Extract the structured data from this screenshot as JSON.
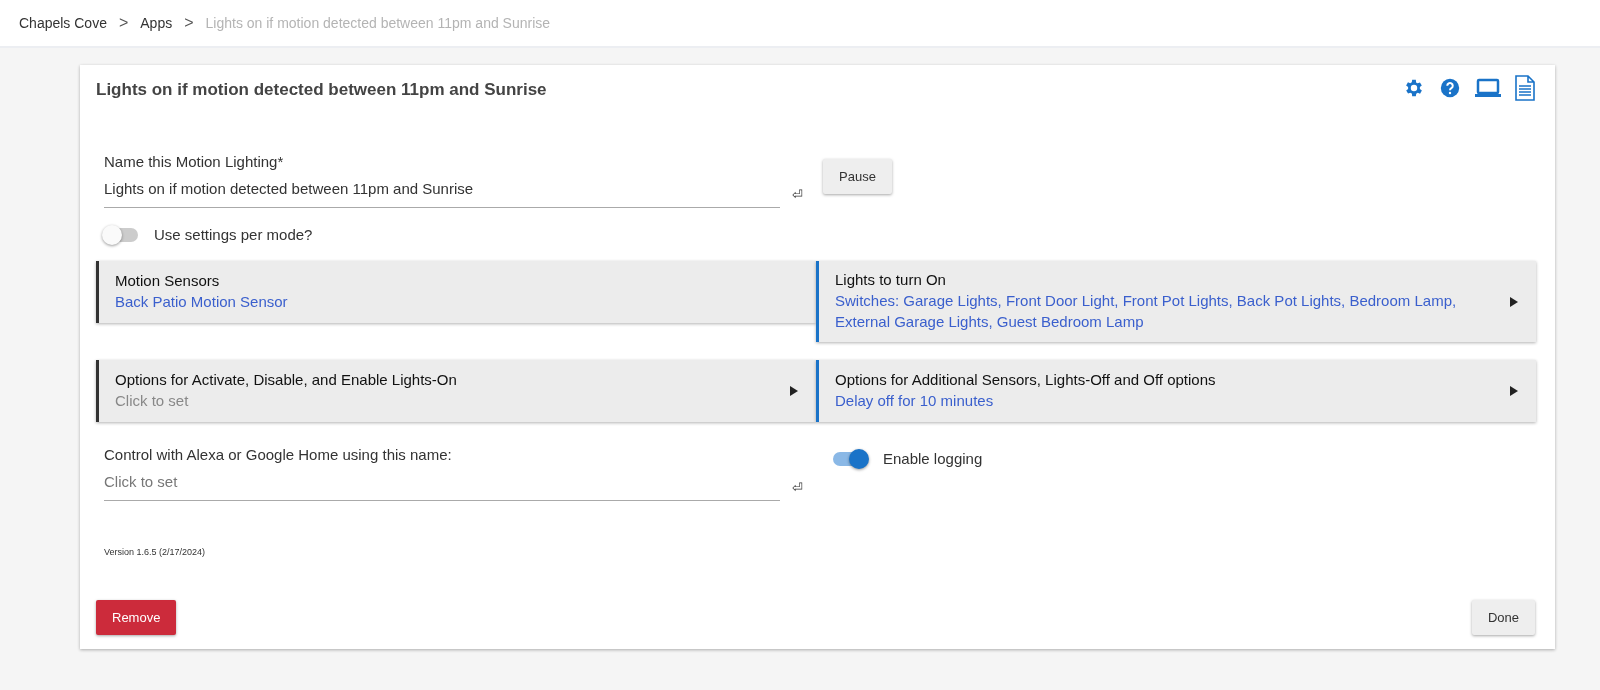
{
  "breadcrumb": [
    {
      "label": "Chapels Cove",
      "current": false
    },
    {
      "label": "Apps",
      "current": false
    },
    {
      "label": "Lights on if motion detected between 11pm and Sunrise",
      "current": true
    }
  ],
  "breadcrumb_separator": ">",
  "card": {
    "title": "Lights on if motion detected between 11pm and Sunrise"
  },
  "name_field": {
    "label": "Name this Motion Lighting*",
    "value": "Lights on if motion detected between 11pm and Sunrise",
    "enter_glyph": "⏎"
  },
  "pause_button": "Pause",
  "mode_toggle": {
    "label": "Use settings per mode?",
    "on": false
  },
  "sections": [
    {
      "title": "Motion Sensors",
      "value": "Back Patio Motion Sensor",
      "set": true,
      "arrow": false,
      "color": "#333333"
    },
    {
      "title": "Lights to turn On",
      "value": "Switches: Garage Lights, Front Door Light, Front Pot Lights, Back Pot Lights, Bedroom Lamp, External Garage Lights, Guest Bedroom Lamp",
      "set": true,
      "arrow": true,
      "color": "#1a73c8"
    },
    {
      "title": "Options for Activate, Disable, and Enable Lights-On",
      "value": "Click to set",
      "set": false,
      "arrow": true,
      "color": "#333333"
    },
    {
      "title": "Options for Additional Sensors, Lights-Off and Off options",
      "value": "Delay off for 10 minutes",
      "set": true,
      "arrow": true,
      "color": "#1a73c8"
    }
  ],
  "alexa_field": {
    "label": "Control with Alexa or Google Home using this name:",
    "placeholder": "Click to set",
    "enter_glyph": "⏎"
  },
  "logging_toggle": {
    "label": "Enable logging",
    "on": true
  },
  "version": "Version 1.6.5 (2/17/2024)",
  "remove_button": "Remove",
  "done_button": "Done"
}
